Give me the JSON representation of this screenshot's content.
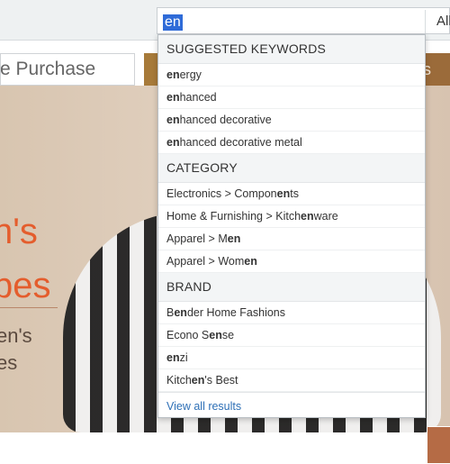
{
  "search": {
    "typed": "en",
    "scope_label": "All"
  },
  "page": {
    "purchase_text": "re Purchase",
    "promo_text": "s ov",
    "hero_title_line1": "n's",
    "hero_title_line2": "pes",
    "hero_sub_line1": "en's",
    "hero_sub_line2": "es"
  },
  "dropdown": {
    "sections": [
      {
        "title": "SUGGESTED KEYWORDS",
        "items": [
          {
            "pre": "",
            "bold": "en",
            "post": "ergy"
          },
          {
            "pre": "",
            "bold": "en",
            "post": "hanced"
          },
          {
            "pre": "",
            "bold": "en",
            "post": "hanced decorative"
          },
          {
            "pre": "",
            "bold": "en",
            "post": "hanced decorative metal"
          }
        ]
      },
      {
        "title": "CATEGORY",
        "items": [
          {
            "pre": "Electronics > Compon",
            "bold": "en",
            "post": "ts"
          },
          {
            "pre": "Home & Furnishing > Kitch",
            "bold": "en",
            "post": "ware"
          },
          {
            "pre": "Apparel > M",
            "bold": "en",
            "post": ""
          },
          {
            "pre": "Apparel > Wom",
            "bold": "en",
            "post": ""
          }
        ]
      },
      {
        "title": "BRAND",
        "items": [
          {
            "pre": "B",
            "bold": "en",
            "post": "der Home Fashions"
          },
          {
            "pre": "Econo S",
            "bold": "en",
            "post": "se"
          },
          {
            "pre": "",
            "bold": "en",
            "post": "zi"
          },
          {
            "pre": "Kitch",
            "bold": "en",
            "post": "'s Best"
          }
        ]
      }
    ],
    "view_all_label": "View all results"
  }
}
